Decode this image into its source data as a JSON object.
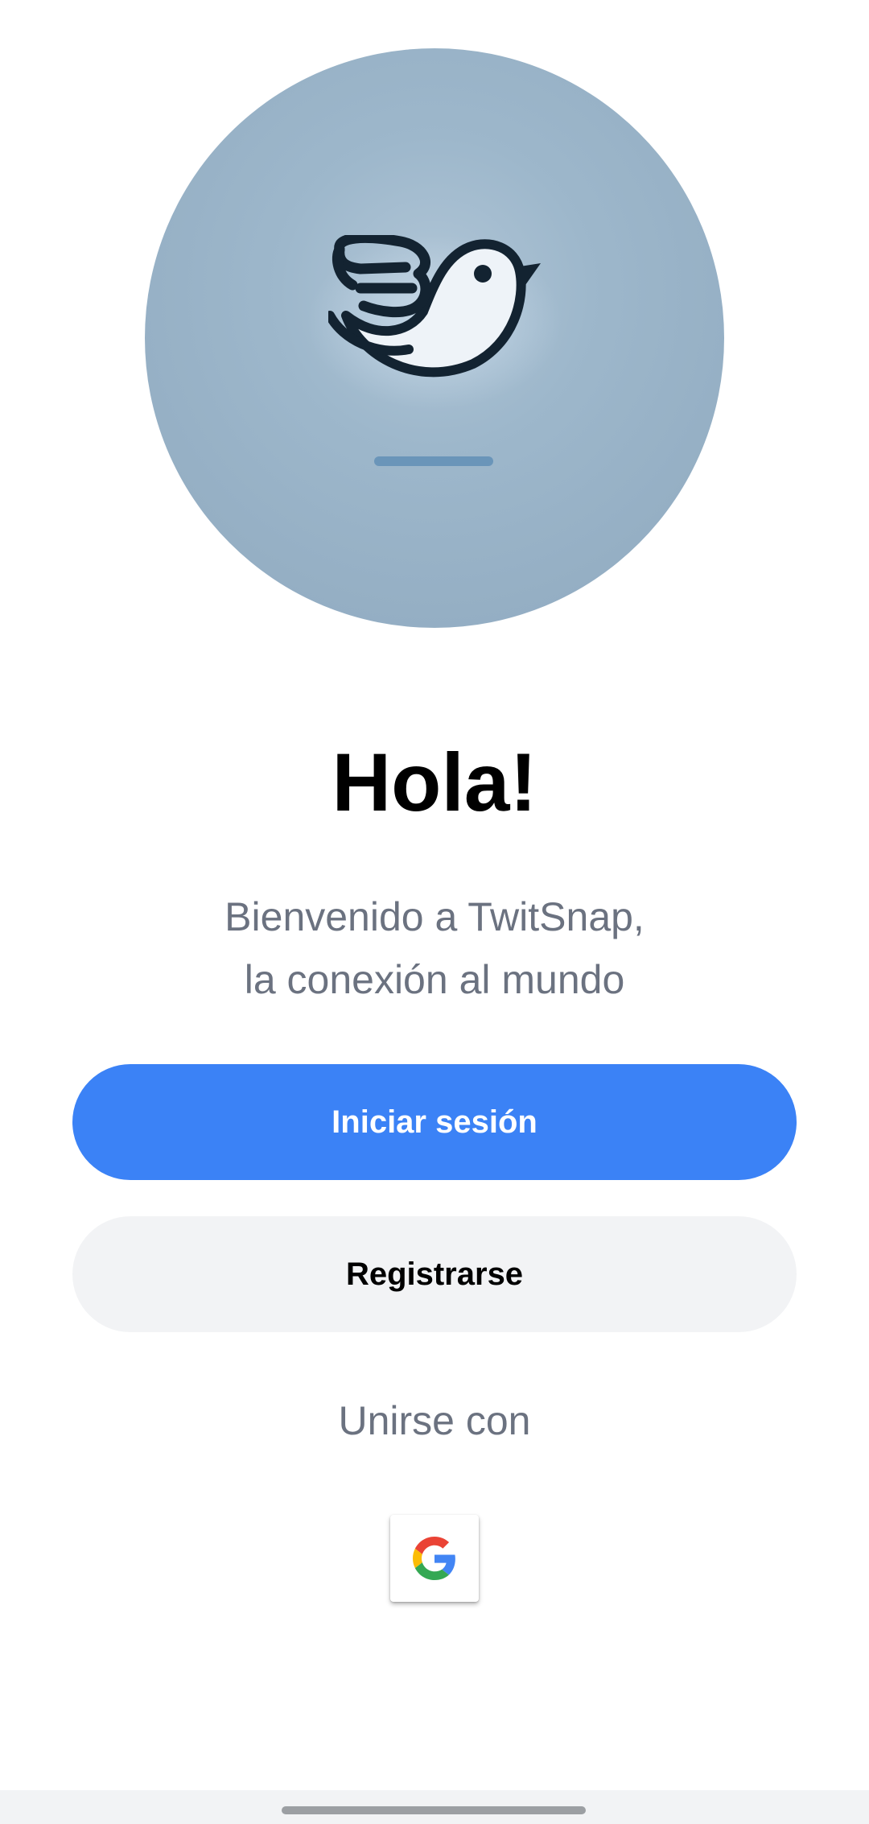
{
  "logo": {
    "icon": "bird-icon",
    "background_color": "#9db7cb"
  },
  "welcome": {
    "title": "Hola!",
    "subtitle_line1": "Bienvenido a TwitSnap,",
    "subtitle_line2": "la conexión al mundo"
  },
  "actions": {
    "login_label": "Iniciar sesión",
    "register_label": "Registrarse"
  },
  "social": {
    "join_label": "Unirse con",
    "providers": [
      {
        "name": "google",
        "icon": "google-icon"
      }
    ]
  },
  "colors": {
    "primary": "#3b82f6",
    "secondary_button": "#f2f3f5",
    "muted_text": "#6b7280",
    "title_text": "#000000"
  },
  "system": {
    "nav_handle": "gesture-handle"
  }
}
